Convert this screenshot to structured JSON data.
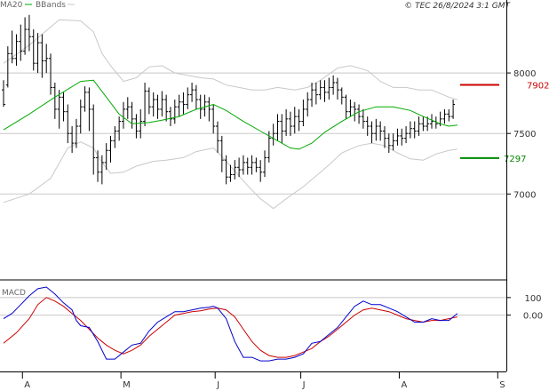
{
  "header": {
    "legend_ma": "MA20",
    "legend_bb": "BBands",
    "copyright": "© TEC 26/8/2024 3:1 GMT"
  },
  "colors": {
    "price": "#000000",
    "ma": "#00aa00",
    "bbands": "#c8c8c8",
    "macd": "#0000cc",
    "signal": "#cc0000",
    "target_high": "#cc0000",
    "target_low": "#008800",
    "grid": "#c8c8c8",
    "frame": "#000000"
  },
  "chart_data": [
    {
      "type": "ohlc",
      "panel": "price",
      "legend": [
        "MA20",
        "BBands"
      ],
      "ylim": [
        6400,
        8500
      ],
      "y_ticks": [
        {
          "value": 7000,
          "label": "7000"
        },
        {
          "value": 7500,
          "label": "7500"
        },
        {
          "value": 8000,
          "label": "8000"
        }
      ],
      "x_ticks": [
        {
          "index": 4,
          "label": "A"
        },
        {
          "index": 27,
          "label": "M"
        },
        {
          "index": 49,
          "label": "J"
        },
        {
          "index": 69,
          "label": "J"
        },
        {
          "index": 92,
          "label": "A"
        },
        {
          "index": 115,
          "label": "S"
        }
      ],
      "n_slots": 116,
      "bars": [
        [
          7860,
          7740,
          7940,
          7720
        ],
        [
          7900,
          8160,
          8220,
          7880
        ],
        [
          8160,
          8120,
          8350,
          8080
        ],
        [
          8120,
          8260,
          8320,
          8060
        ],
        [
          8260,
          8180,
          8400,
          8100
        ],
        [
          8180,
          8360,
          8460,
          8150
        ],
        [
          8360,
          8300,
          8480,
          8180
        ],
        [
          8300,
          8080,
          8360,
          8020
        ],
        [
          8080,
          8250,
          8330,
          8000
        ],
        [
          8250,
          8100,
          8320,
          7960
        ],
        [
          8100,
          8120,
          8240,
          8000
        ],
        [
          8120,
          7880,
          8160,
          7820
        ],
        [
          7880,
          7700,
          7920,
          7620
        ],
        [
          7700,
          7800,
          7860,
          7540
        ],
        [
          7800,
          7680,
          7840,
          7600
        ],
        [
          7680,
          7500,
          7740,
          7420
        ],
        [
          7500,
          7420,
          7560,
          7340
        ],
        [
          7420,
          7560,
          7620,
          7380
        ],
        [
          7560,
          7720,
          7780,
          7500
        ],
        [
          7720,
          7840,
          7890,
          7680
        ],
        [
          7840,
          7700,
          7880,
          7520
        ],
        [
          7700,
          7300,
          7740,
          7160
        ],
        [
          7300,
          7180,
          7360,
          7100
        ],
        [
          7180,
          7260,
          7320,
          7080
        ],
        [
          7260,
          7360,
          7420,
          7200
        ],
        [
          7360,
          7440,
          7480,
          7260
        ],
        [
          7440,
          7520,
          7560,
          7380
        ],
        [
          7520,
          7600,
          7640,
          7440
        ],
        [
          7600,
          7700,
          7760,
          7540
        ],
        [
          7700,
          7720,
          7800,
          7620
        ],
        [
          7720,
          7620,
          7760,
          7540
        ],
        [
          7620,
          7520,
          7660,
          7460
        ],
        [
          7520,
          7600,
          7700,
          7460
        ],
        [
          7600,
          7850,
          7920,
          7560
        ],
        [
          7850,
          7720,
          7880,
          7660
        ],
        [
          7720,
          7780,
          7840,
          7640
        ],
        [
          7780,
          7700,
          7820,
          7620
        ],
        [
          7700,
          7780,
          7850,
          7640
        ],
        [
          7780,
          7680,
          7820,
          7600
        ],
        [
          7680,
          7620,
          7720,
          7560
        ],
        [
          7620,
          7720,
          7780,
          7580
        ],
        [
          7720,
          7760,
          7820,
          7640
        ],
        [
          7760,
          7740,
          7840,
          7660
        ],
        [
          7740,
          7820,
          7880,
          7700
        ],
        [
          7820,
          7860,
          7920,
          7760
        ],
        [
          7860,
          7780,
          7900,
          7700
        ],
        [
          7780,
          7700,
          7820,
          7620
        ],
        [
          7700,
          7760,
          7820,
          7640
        ],
        [
          7760,
          7700,
          7800,
          7600
        ],
        [
          7700,
          7560,
          7740,
          7500
        ],
        [
          7560,
          7440,
          7600,
          7340
        ],
        [
          7440,
          7280,
          7480,
          7180
        ],
        [
          7280,
          7140,
          7320,
          7080
        ],
        [
          7140,
          7160,
          7240,
          7100
        ],
        [
          7160,
          7220,
          7280,
          7120
        ],
        [
          7220,
          7200,
          7300,
          7140
        ],
        [
          7200,
          7260,
          7320,
          7160
        ],
        [
          7260,
          7220,
          7300,
          7160
        ],
        [
          7220,
          7260,
          7320,
          7160
        ],
        [
          7260,
          7220,
          7300,
          7180
        ],
        [
          7220,
          7180,
          7280,
          7100
        ],
        [
          7180,
          7300,
          7360,
          7140
        ],
        [
          7300,
          7460,
          7520,
          7260
        ],
        [
          7460,
          7500,
          7580,
          7400
        ],
        [
          7500,
          7600,
          7660,
          7440
        ],
        [
          7600,
          7520,
          7660,
          7420
        ],
        [
          7520,
          7620,
          7700,
          7480
        ],
        [
          7620,
          7560,
          7680,
          7480
        ],
        [
          7560,
          7640,
          7720,
          7500
        ],
        [
          7640,
          7600,
          7700,
          7520
        ],
        [
          7600,
          7700,
          7780,
          7560
        ],
        [
          7700,
          7780,
          7840,
          7640
        ],
        [
          7780,
          7860,
          7920,
          7720
        ],
        [
          7860,
          7820,
          7920,
          7740
        ],
        [
          7820,
          7880,
          7940,
          7780
        ],
        [
          7880,
          7840,
          7940,
          7760
        ],
        [
          7840,
          7880,
          7960,
          7780
        ],
        [
          7880,
          7920,
          7980,
          7820
        ],
        [
          7920,
          7860,
          7960,
          7780
        ],
        [
          7860,
          7800,
          7880,
          7740
        ],
        [
          7800,
          7680,
          7820,
          7620
        ],
        [
          7680,
          7720,
          7780,
          7640
        ],
        [
          7720,
          7700,
          7760,
          7600
        ],
        [
          7700,
          7640,
          7740,
          7580
        ],
        [
          7640,
          7600,
          7700,
          7540
        ],
        [
          7600,
          7560,
          7640,
          7480
        ],
        [
          7560,
          7500,
          7600,
          7420
        ],
        [
          7500,
          7560,
          7620,
          7440
        ],
        [
          7560,
          7520,
          7600,
          7440
        ],
        [
          7520,
          7460,
          7560,
          7380
        ],
        [
          7460,
          7400,
          7500,
          7340
        ],
        [
          7400,
          7440,
          7500,
          7360
        ],
        [
          7440,
          7480,
          7540,
          7400
        ],
        [
          7480,
          7460,
          7540,
          7400
        ],
        [
          7460,
          7500,
          7560,
          7420
        ],
        [
          7500,
          7540,
          7600,
          7460
        ],
        [
          7540,
          7520,
          7600,
          7460
        ],
        [
          7520,
          7580,
          7640,
          7480
        ],
        [
          7580,
          7560,
          7640,
          7520
        ],
        [
          7560,
          7580,
          7640,
          7520
        ],
        [
          7580,
          7600,
          7660,
          7540
        ],
        [
          7600,
          7580,
          7640,
          7540
        ],
        [
          7580,
          7620,
          7680,
          7560
        ],
        [
          7620,
          7660,
          7700,
          7580
        ],
        [
          7660,
          7640,
          7700,
          7600
        ],
        [
          7640,
          7740,
          7780,
          7620
        ]
      ],
      "ma20": [
        [
          0,
          7530
        ],
        [
          6,
          7660
        ],
        [
          12,
          7800
        ],
        [
          18,
          7930
        ],
        [
          21,
          7940
        ],
        [
          24,
          7800
        ],
        [
          27,
          7660
        ],
        [
          30,
          7580
        ],
        [
          34,
          7590
        ],
        [
          37,
          7610
        ],
        [
          41,
          7640
        ],
        [
          45,
          7700
        ],
        [
          49,
          7740
        ],
        [
          52,
          7690
        ],
        [
          56,
          7600
        ],
        [
          60,
          7520
        ],
        [
          64,
          7440
        ],
        [
          67,
          7380
        ],
        [
          69,
          7370
        ],
        [
          72,
          7420
        ],
        [
          75,
          7510
        ],
        [
          79,
          7600
        ],
        [
          83,
          7680
        ],
        [
          87,
          7720
        ],
        [
          91,
          7720
        ],
        [
          95,
          7690
        ],
        [
          98,
          7640
        ],
        [
          102,
          7580
        ],
        [
          104,
          7560
        ],
        [
          106,
          7570
        ]
      ],
      "bb_upper": [
        [
          0,
          8080
        ],
        [
          6,
          8230
        ],
        [
          9,
          8320
        ],
        [
          13,
          8440
        ],
        [
          18,
          8430
        ],
        [
          21,
          8340
        ],
        [
          23,
          8160
        ],
        [
          25,
          8060
        ],
        [
          28,
          7930
        ],
        [
          31,
          7960
        ],
        [
          34,
          8050
        ],
        [
          37,
          8060
        ],
        [
          40,
          8000
        ],
        [
          43,
          7980
        ],
        [
          46,
          7960
        ],
        [
          49,
          7950
        ],
        [
          52,
          7900
        ],
        [
          55,
          7880
        ],
        [
          58,
          7860
        ],
        [
          61,
          7860
        ],
        [
          64,
          7880
        ],
        [
          68,
          7860
        ],
        [
          71,
          7880
        ],
        [
          74,
          7940
        ],
        [
          78,
          8040
        ],
        [
          81,
          8060
        ],
        [
          85,
          8020
        ],
        [
          88,
          7930
        ],
        [
          91,
          7880
        ],
        [
          94,
          7880
        ],
        [
          97,
          7860
        ],
        [
          100,
          7860
        ],
        [
          104,
          7800
        ],
        [
          106,
          7780
        ]
      ],
      "bb_lower": [
        [
          0,
          6930
        ],
        [
          6,
          7000
        ],
        [
          11,
          7130
        ],
        [
          15,
          7380
        ],
        [
          18,
          7430
        ],
        [
          21,
          7380
        ],
        [
          23,
          7260
        ],
        [
          25,
          7170
        ],
        [
          28,
          7180
        ],
        [
          31,
          7230
        ],
        [
          35,
          7270
        ],
        [
          38,
          7280
        ],
        [
          42,
          7300
        ],
        [
          45,
          7350
        ],
        [
          49,
          7380
        ],
        [
          51,
          7310
        ],
        [
          54,
          7190
        ],
        [
          57,
          7070
        ],
        [
          60,
          6960
        ],
        [
          63,
          6880
        ],
        [
          66,
          6960
        ],
        [
          70,
          7060
        ],
        [
          73,
          7150
        ],
        [
          76,
          7240
        ],
        [
          79,
          7340
        ],
        [
          83,
          7400
        ],
        [
          86,
          7420
        ],
        [
          89,
          7400
        ],
        [
          92,
          7340
        ],
        [
          95,
          7290
        ],
        [
          98,
          7280
        ],
        [
          101,
          7330
        ],
        [
          104,
          7360
        ],
        [
          106,
          7370
        ]
      ],
      "targets": [
        {
          "value": 7902,
          "label": "7902",
          "color": "#cc0000"
        },
        {
          "value": 7297,
          "label": "7297",
          "color": "#008800"
        }
      ]
    },
    {
      "type": "line",
      "panel": "macd",
      "title": "MACD",
      "ylim": [
        -300,
        175
      ],
      "y_ticks": [
        {
          "value": 100,
          "label": "100"
        },
        {
          "value": 0,
          "label": "0.00"
        }
      ],
      "series": [
        {
          "name": "MACD",
          "color": "#0000cc",
          "x": [
            0,
            2,
            4,
            6,
            8,
            10,
            12,
            14,
            16,
            17,
            18,
            20,
            22,
            24,
            26,
            28,
            30,
            32,
            34,
            36,
            38,
            40,
            42,
            44,
            46,
            48,
            49,
            50,
            52,
            54,
            56,
            58,
            60,
            62,
            64,
            66,
            68,
            70,
            72,
            74,
            76,
            78,
            80,
            82,
            84,
            86,
            88,
            90,
            92,
            94,
            96,
            98,
            100,
            102,
            104,
            106
          ],
          "y": [
            -20,
            10,
            60,
            110,
            150,
            160,
            120,
            70,
            30,
            -30,
            -60,
            -70,
            -150,
            -250,
            -250,
            -210,
            -170,
            -160,
            -90,
            -40,
            -10,
            20,
            20,
            30,
            40,
            45,
            50,
            40,
            -20,
            -150,
            -240,
            -240,
            -260,
            -260,
            -250,
            -250,
            -240,
            -220,
            -160,
            -150,
            -110,
            -70,
            -10,
            50,
            80,
            60,
            60,
            40,
            20,
            -10,
            -40,
            -40,
            -20,
            -30,
            -30,
            10
          ]
        },
        {
          "name": "Signal",
          "color": "#cc0000",
          "x": [
            0,
            3,
            6,
            8,
            10,
            12,
            14,
            16,
            18,
            20,
            22,
            24,
            26,
            28,
            30,
            32,
            34,
            36,
            38,
            40,
            42,
            44,
            46,
            48,
            50,
            52,
            54,
            56,
            58,
            60,
            62,
            64,
            66,
            68,
            70,
            72,
            74,
            76,
            78,
            80,
            82,
            84,
            86,
            88,
            90,
            92,
            94,
            96,
            98,
            100,
            102,
            104,
            106
          ],
          "y": [
            -160,
            -100,
            -20,
            60,
            100,
            80,
            50,
            10,
            -30,
            -80,
            -130,
            -170,
            -200,
            -220,
            -200,
            -170,
            -120,
            -80,
            -40,
            0,
            10,
            20,
            25,
            35,
            40,
            30,
            -10,
            -80,
            -150,
            -200,
            -230,
            -240,
            -240,
            -230,
            -210,
            -190,
            -150,
            -120,
            -80,
            -40,
            0,
            30,
            40,
            30,
            20,
            0,
            -20,
            -30,
            -40,
            -30,
            -30,
            -20,
            -10
          ]
        }
      ]
    }
  ]
}
